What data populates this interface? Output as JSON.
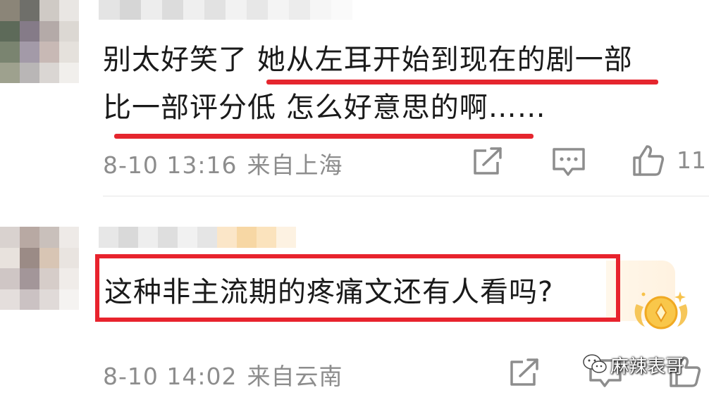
{
  "comments": [
    {
      "lines": [
        "别太好笑了 她从左耳开始到现在的剧一部",
        "比一部评分低 怎么好意思的啊……"
      ],
      "timestamp": "8-10 13:16",
      "location": "来自上海",
      "likes": "11"
    },
    {
      "lines": [
        "这种非主流期的疼痛文还有人看吗?"
      ],
      "timestamp": "8-10 14:02",
      "location": "来自云南"
    }
  ],
  "watermark": "麻辣表哥",
  "colors": {
    "highlight_red": "#e8232d",
    "meta_gray": "#8d8d8d",
    "text": "#1a1a1a"
  },
  "icons": [
    "share-icon",
    "comment-icon",
    "like-icon",
    "wechat-icon",
    "fan-badge-icon"
  ]
}
